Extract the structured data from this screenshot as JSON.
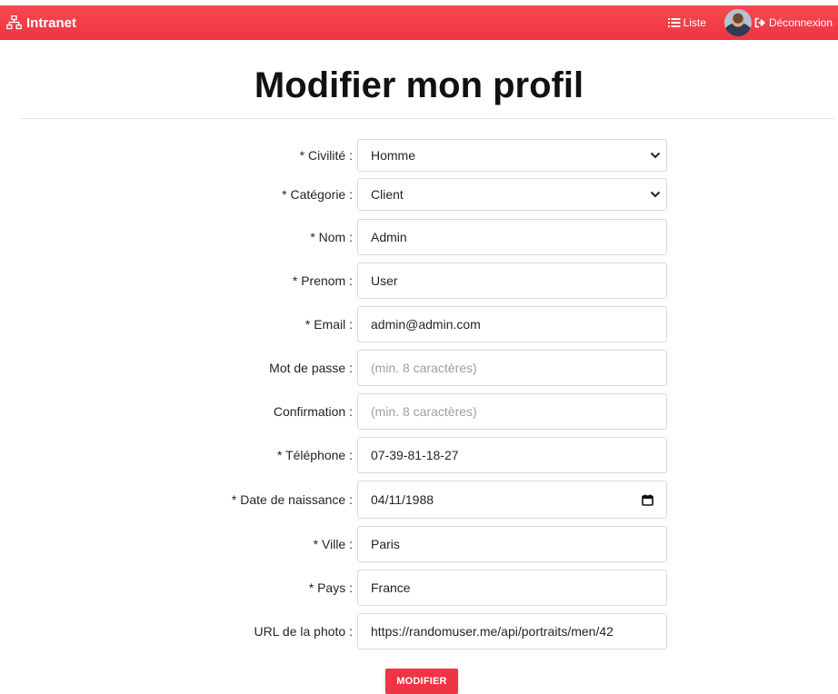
{
  "navbar": {
    "brand": "Intranet",
    "brand_icon": "sitemap-icon",
    "list_label": "Liste",
    "list_icon": "list-icon",
    "logout_label": "Déconnexion",
    "logout_icon": "sign-out-icon",
    "accent_color": "#ee3544"
  },
  "page": {
    "title": "Modifier mon profil"
  },
  "form": {
    "civilite": {
      "label": "* Civilité :",
      "value": "Homme"
    },
    "categorie": {
      "label": "* Catégorie :",
      "value": "Client"
    },
    "nom": {
      "label": "* Nom :",
      "value": "Admin"
    },
    "prenom": {
      "label": "* Prenom :",
      "value": "User"
    },
    "email": {
      "label": "* Email :",
      "value": "admin@admin.com"
    },
    "password": {
      "label": "Mot de passe :",
      "placeholder": "(min. 8 caractères)"
    },
    "confirmation": {
      "label": "Confirmation :",
      "placeholder": "(min. 8 caractères)"
    },
    "telephone": {
      "label": "* Téléphone :",
      "value": "07-39-81-18-27"
    },
    "birthdate": {
      "label": "* Date de naissance :",
      "value": "04/11/1988"
    },
    "ville": {
      "label": "* Ville :",
      "value": "Paris"
    },
    "pays": {
      "label": "* Pays :",
      "value": "France"
    },
    "photo": {
      "label": "URL de la photo :",
      "value": "https://randomuser.me/api/portraits/men/42"
    },
    "submit_label": "MODIFIER"
  }
}
